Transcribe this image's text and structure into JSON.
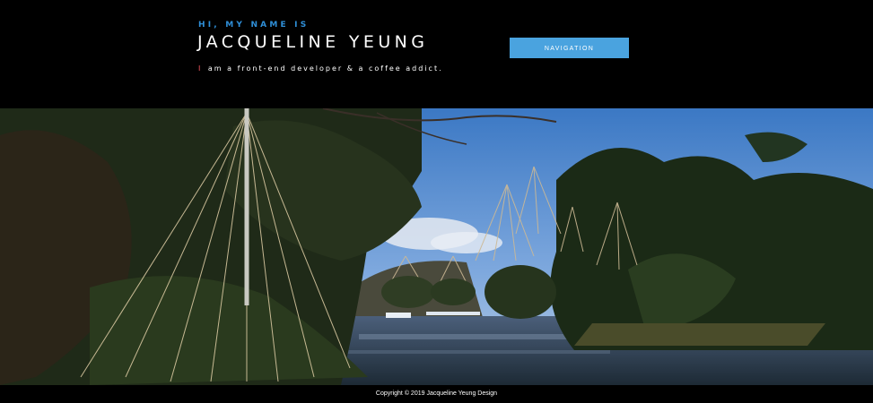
{
  "header": {
    "intro": "HI, MY NAME IS",
    "name": "JACQUELINE YEUNG",
    "tagline_cursor": "I",
    "tagline": "am a front-end developer & a coffee addict.",
    "nav_label": "NAVIGATION"
  },
  "hero": {
    "image_semantic": "japanese-garden-photo"
  },
  "footer": {
    "copyright": "Copyright © 2019 Jacqueline Yeung Design"
  },
  "colors": {
    "background": "#000000",
    "accent_blue": "#4aa3df",
    "intro_blue": "#2f8fd8",
    "cursor_red": "#ff5a63"
  }
}
